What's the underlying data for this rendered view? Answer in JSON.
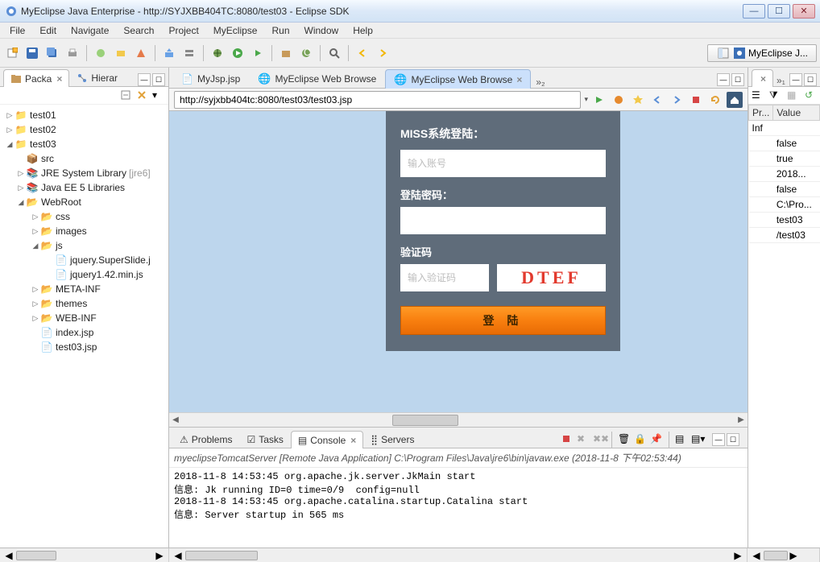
{
  "window": {
    "title": "MyEclipse Java Enterprise - http://SYJXBB404TC:8080/test03 - Eclipse SDK"
  },
  "menu": [
    "File",
    "Edit",
    "Navigate",
    "Search",
    "Project",
    "MyEclipse",
    "Run",
    "Window",
    "Help"
  ],
  "perspective": {
    "label": "MyEclipse J..."
  },
  "left_tabs": {
    "packa": "Packa",
    "hierar": "Hierar"
  },
  "tree": {
    "test01": "test01",
    "test02": "test02",
    "test03": "test03",
    "src": "src",
    "jre": "JRE System Library",
    "jre_suffix": "[jre6]",
    "javaee": "Java EE 5 Libraries",
    "webroot": "WebRoot",
    "css": "css",
    "images": "images",
    "js": "js",
    "superslide": "jquery.SuperSlide.j",
    "jqmin": "jquery1.42.min.js",
    "metainf": "META-INF",
    "themes": "themes",
    "webinf": "WEB-INF",
    "indexjsp": "index.jsp",
    "test03jsp": "test03.jsp"
  },
  "editor_tabs": {
    "t1": "MyJsp.jsp",
    "t2": "MyEclipse Web Browse",
    "t3": "MyEclipse Web Browse",
    "more": "»₂"
  },
  "url": "http://syjxbb404tc:8080/test03/test03.jsp",
  "login": {
    "heading": "MISS系统登陆：",
    "account_placeholder": "输入账号",
    "pwd_label": "登陆密码：",
    "captcha_label": "验证码",
    "captcha_placeholder": "输入验证码",
    "captcha_value": "DTEF",
    "button": "登 陆"
  },
  "bottom_tabs": {
    "problems": "Problems",
    "tasks": "Tasks",
    "console": "Console",
    "servers": "Servers"
  },
  "console": {
    "desc": "myeclipseTomcatServer [Remote Java Application] C:\\Program Files\\Java\\jre6\\bin\\javaw.exe (2018-11-8 下午02:53:44)",
    "body": "2018-11-8 14:53:45 org.apache.jk.server.JkMain start\n信息: Jk running ID=0 time=0/9  config=null\n2018-11-8 14:53:45 org.apache.catalina.startup.Catalina start\n信息: Server startup in 565 ms"
  },
  "right_tabs": {
    "more": "»₁"
  },
  "props": {
    "col1": "Pr...",
    "col2": "Value",
    "rows": [
      [
        "Inf",
        ""
      ],
      [
        "",
        "false"
      ],
      [
        "",
        "true"
      ],
      [
        "",
        "2018..."
      ],
      [
        "",
        "false"
      ],
      [
        "",
        "C:\\Pro..."
      ],
      [
        "",
        "test03"
      ],
      [
        "",
        "/test03"
      ]
    ]
  }
}
